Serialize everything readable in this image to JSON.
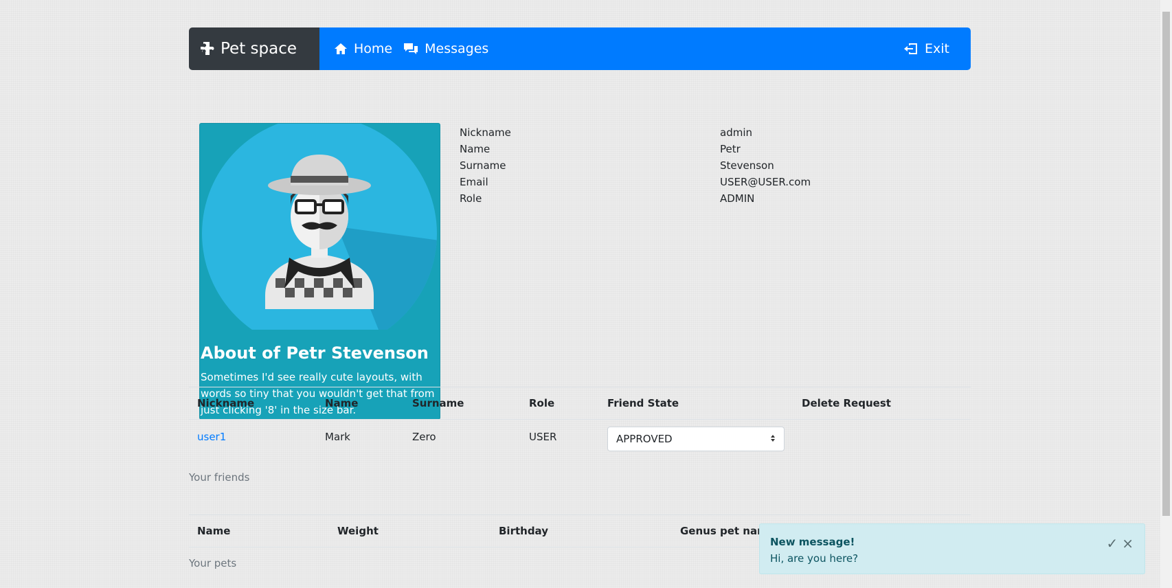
{
  "nav": {
    "brand": "Pet space",
    "home": "Home",
    "messages": "Messages",
    "exit": "Exit"
  },
  "card": {
    "title": "About of Petr Stevenson",
    "text": "Sometimes I'd see really cute layouts, with words so tiny that you wouldn't get that from just clicking '8' in the size bar."
  },
  "profile": [
    {
      "label": "Nickname",
      "value": "admin"
    },
    {
      "label": "Name",
      "value": "Petr"
    },
    {
      "label": "Surname",
      "value": "Stevenson"
    },
    {
      "label": "Email",
      "value": "USER@USER.com"
    },
    {
      "label": "Role",
      "value": "ADMIN"
    }
  ],
  "friends_table": {
    "headers": [
      "Nickname",
      "Name",
      "Surname",
      "Role",
      "Friend State",
      "Delete Request"
    ],
    "rows": [
      {
        "nickname": "user1",
        "name": "Mark",
        "surname": "Zero",
        "role": "USER",
        "state": "APPROVED"
      }
    ],
    "caption": "Your friends"
  },
  "pets_table": {
    "headers": [
      "Name",
      "Weight",
      "Birthday",
      "Genus pet name"
    ],
    "caption": "Your pets"
  },
  "toast": {
    "title": "New message!",
    "body": "Hi, are you here?",
    "check": "✓",
    "close": "×"
  },
  "colors": {
    "primary": "#007bff",
    "dark": "#343a40",
    "info": "#17a2b8",
    "toast_bg": "#d1ecf1"
  }
}
